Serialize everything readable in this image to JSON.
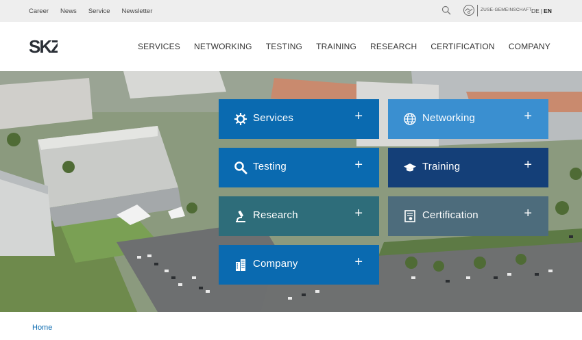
{
  "topbar": {
    "links": [
      "Career",
      "News",
      "Service",
      "Newsletter"
    ],
    "zuse_label": "ZUSE-GEMEINSCHAFT",
    "lang_de": "DE",
    "lang_sep": "|",
    "lang_en": "EN"
  },
  "logo": {
    "text": "SKZ"
  },
  "nav": [
    "SERVICES",
    "NETWORKING",
    "TESTING",
    "TRAINING",
    "RESEARCH",
    "CERTIFICATION",
    "COMPANY"
  ],
  "tiles": [
    {
      "label": "Services",
      "icon": "gear-icon",
      "color": "#0a6ab0"
    },
    {
      "label": "Networking",
      "icon": "globe-icon",
      "color": "#3a8fd0"
    },
    {
      "label": "Testing",
      "icon": "search-icon",
      "color": "#0a6ab0"
    },
    {
      "label": "Training",
      "icon": "graduation-cap-icon",
      "color": "#143f78"
    },
    {
      "label": "Research",
      "icon": "microscope-icon",
      "color": "#2e6d7a"
    },
    {
      "label": "Certification",
      "icon": "certificate-icon",
      "color": "#4d6c7c"
    },
    {
      "label": "Company",
      "icon": "building-icon",
      "color": "#0a6ab0"
    }
  ],
  "tile_plus": "+",
  "breadcrumb": {
    "home": "Home"
  }
}
